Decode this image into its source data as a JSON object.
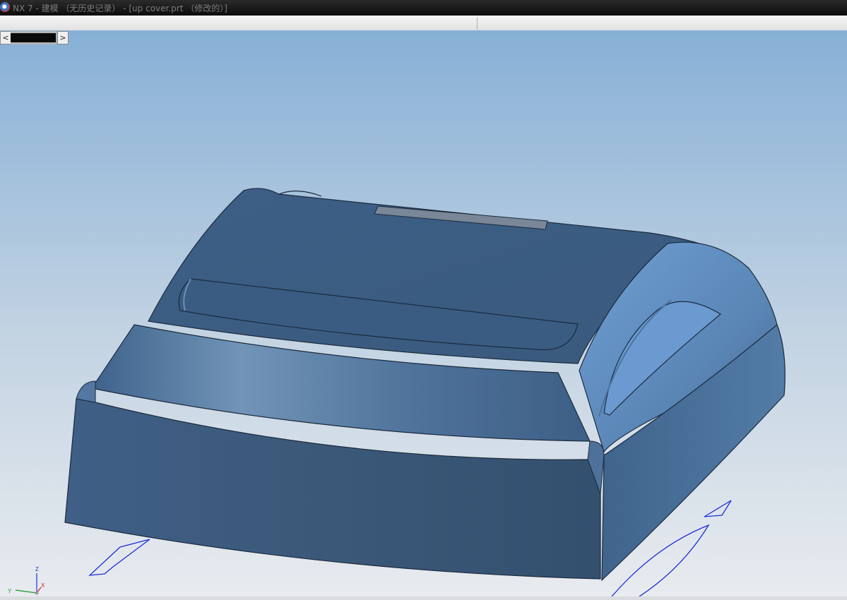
{
  "window": {
    "title": "NX 7 - 建模 （无历史记录） - [up cover.prt （修改的）]",
    "app_icon": "nx-logo-icon"
  },
  "scrollbar": {
    "left_arrow": "<",
    "right_arrow": ">"
  },
  "viewport": {
    "background_top": "#87b0d6",
    "background_bottom": "#e8ebef",
    "model_color": "#45678f"
  },
  "triad": {
    "z_label": "Z",
    "y_label": "Y",
    "x_label": "X"
  }
}
